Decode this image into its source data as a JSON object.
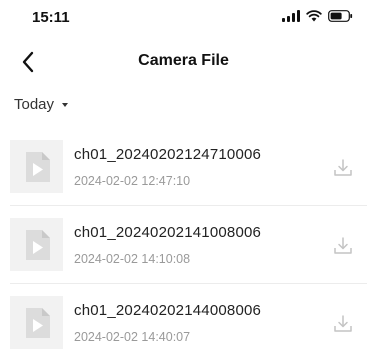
{
  "status_bar": {
    "time": "15:11",
    "icons": [
      "signal-icon",
      "wifi-icon",
      "battery-icon"
    ]
  },
  "header": {
    "title": "Camera File",
    "back_icon": "chevron-left-icon"
  },
  "filter": {
    "label": "Today",
    "icon": "caret-down-icon"
  },
  "files": [
    {
      "name": "ch01_20240202124710006",
      "timestamp": "2024-02-02 12:47:10"
    },
    {
      "name": "ch01_20240202141008006",
      "timestamp": "2024-02-02 14:10:08"
    },
    {
      "name": "ch01_20240202144008006",
      "timestamp": "2024-02-02 14:40:07"
    }
  ],
  "colors": {
    "text_primary": "#222222",
    "text_secondary": "#9a9a9a",
    "thumbnail_bg": "#f2f2f2",
    "divider": "#ececec"
  }
}
